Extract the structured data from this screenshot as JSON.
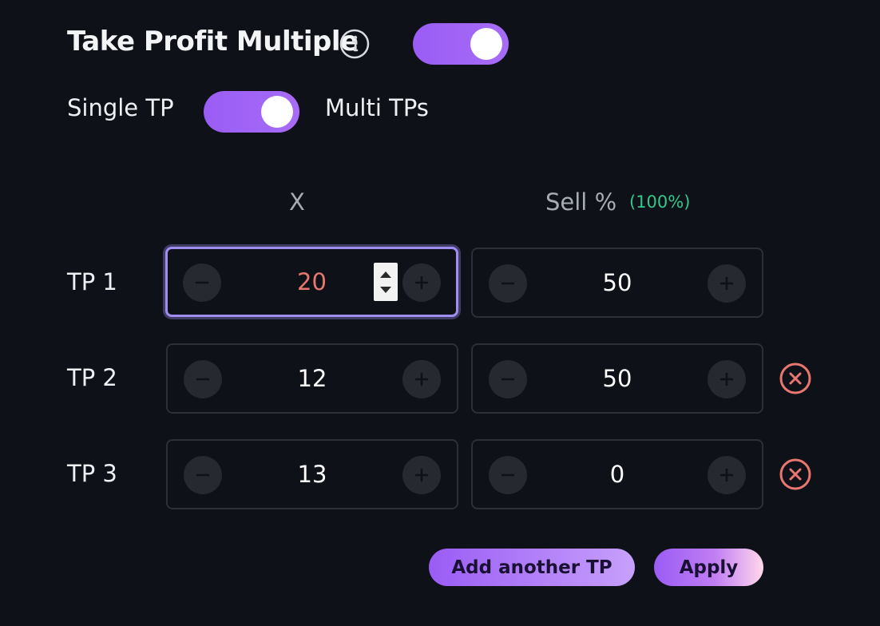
{
  "header": {
    "title": "Take Profit Multiple",
    "enabled": true
  },
  "mode": {
    "left_label": "Single TP",
    "right_label": "Multi TPs",
    "multi_selected": true
  },
  "columns": {
    "x_label": "X",
    "sell_label": "Sell %",
    "sell_total": "(100%)"
  },
  "rows": [
    {
      "label": "TP 1",
      "x": "20",
      "sell": "50",
      "removable": false
    },
    {
      "label": "TP 2",
      "x": "12",
      "sell": "50",
      "removable": true
    },
    {
      "label": "TP 3",
      "x": "13",
      "sell": "0",
      "removable": true
    }
  ],
  "actions": {
    "add_label": "Add another TP",
    "apply_label": "Apply"
  },
  "colors": {
    "accent": "#9a5cf5",
    "background": "#0e1117",
    "invalid_value": "#e8786f",
    "remove": "#e8786f",
    "total_ok": "#34c78a"
  },
  "icons": {
    "info": "info-icon",
    "minus": "minus-icon",
    "plus": "plus-icon",
    "remove": "close-circle-icon",
    "spinner": "spinner-arrows-icon"
  }
}
